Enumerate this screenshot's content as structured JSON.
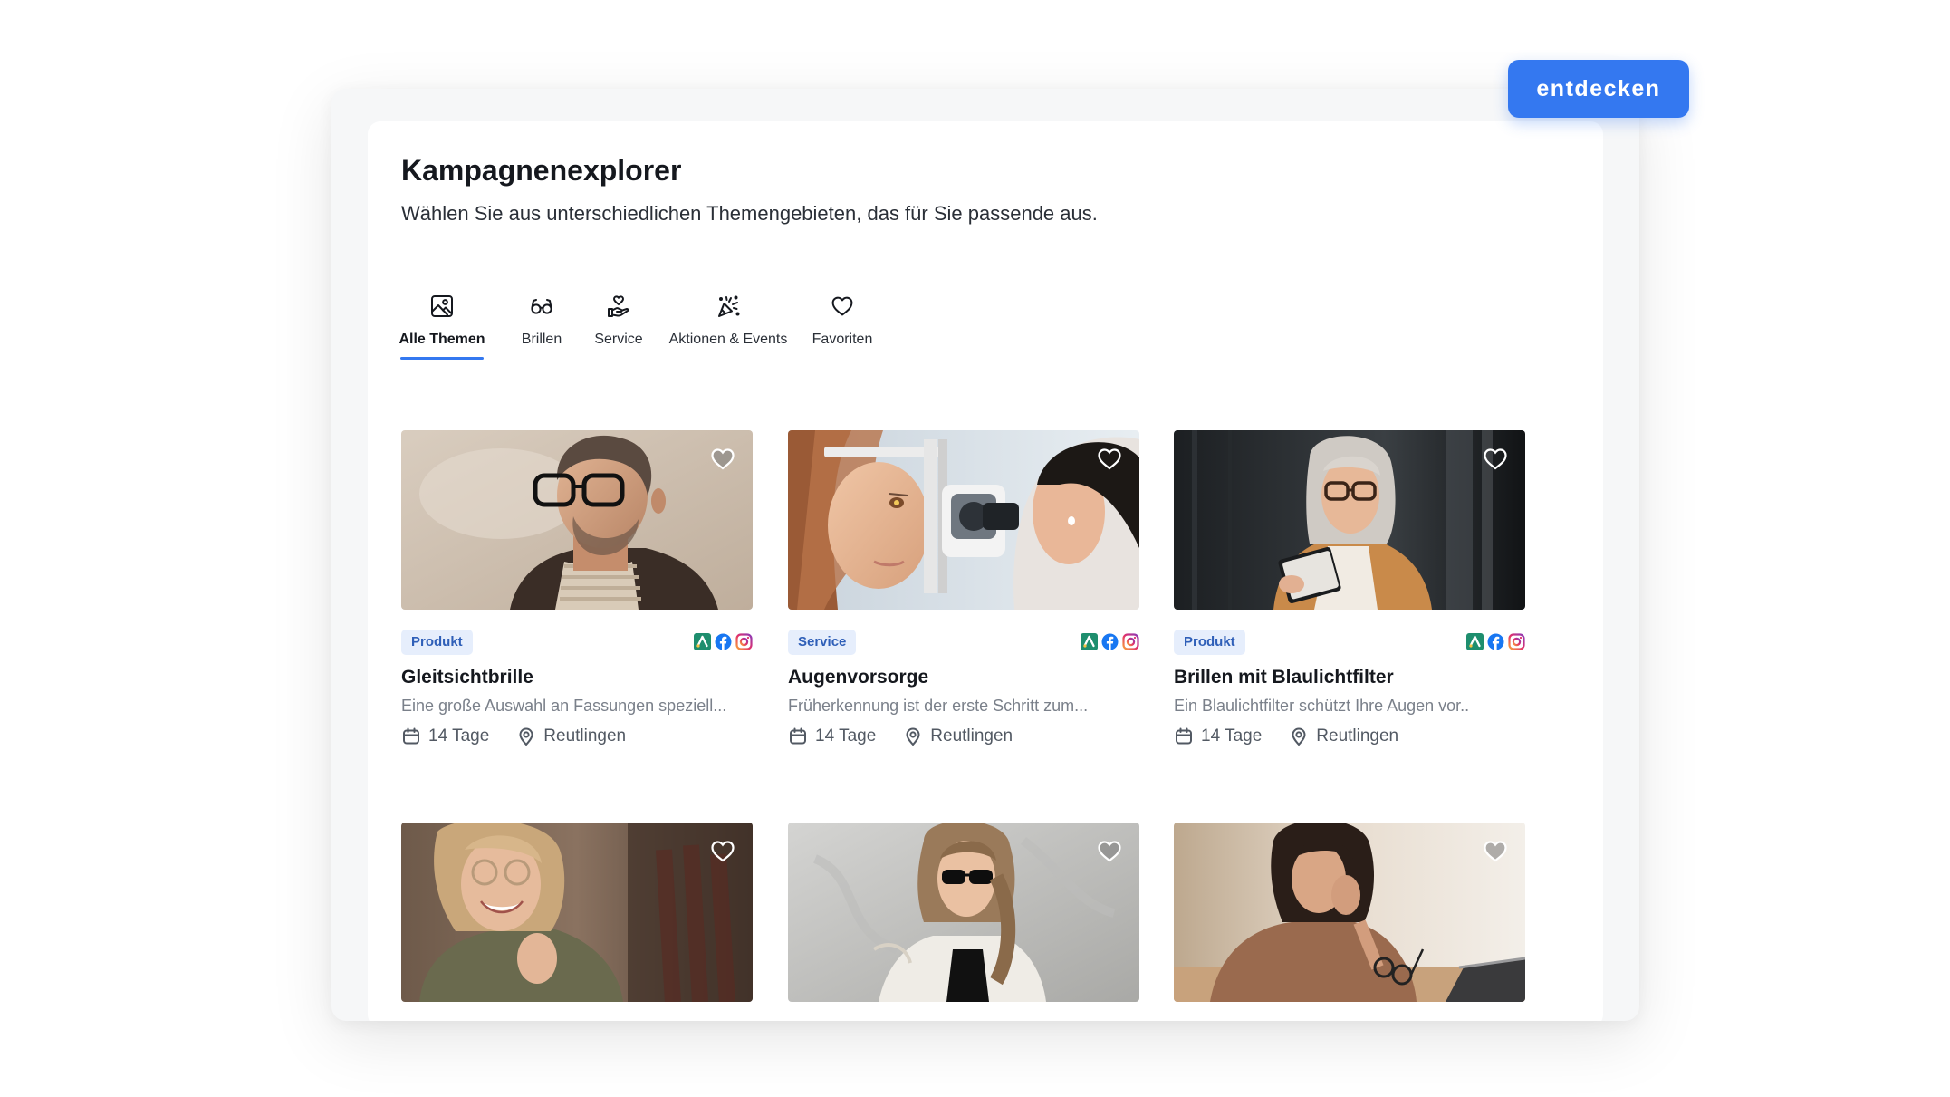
{
  "header": {
    "title": "Kampagnenexplorer",
    "subtitle": "Wählen Sie aus unterschiedlichen Themengebieten, das für Sie passende aus.",
    "discover_label": "entdecken"
  },
  "tabs": [
    {
      "label": "Alle Themen",
      "icon": "image-icon",
      "active": true
    },
    {
      "label": "Brillen",
      "icon": "glasses-icon",
      "active": false
    },
    {
      "label": "Service",
      "icon": "hand-heart-icon",
      "active": false
    },
    {
      "label": "Aktionen & Events",
      "icon": "sparkles-icon",
      "active": false
    },
    {
      "label": "Favoriten",
      "icon": "heart-icon",
      "active": false
    }
  ],
  "cards": [
    {
      "category": "Produkt",
      "title": "Gleitsichtbrille",
      "description": "Eine große Auswahl an Fassungen speziell...",
      "duration": "14 Tage",
      "location": "Reutlingen",
      "favorite_icon": "heart-outline-icon"
    },
    {
      "category": "Service",
      "title": "Augenvorsorge",
      "description": "Früherkennung ist der erste Schritt zum...",
      "duration": "14 Tage",
      "location": "Reutlingen",
      "favorite_icon": "heart-outline-icon"
    },
    {
      "category": "Produkt",
      "title": "Brillen mit Blaulichtfilter",
      "description": "Ein Blaulichtfilter schützt Ihre Augen vor..",
      "duration": "14 Tage",
      "location": "Reutlingen",
      "favorite_icon": "heart-outline-icon"
    },
    {
      "favorite_icon": "heart-outline-icon"
    },
    {
      "favorite_icon": "heart-outline-icon"
    },
    {
      "favorite_icon": "heart-outline-icon"
    }
  ],
  "social_icons": [
    "google-ads-icon",
    "facebook-icon",
    "instagram-icon"
  ],
  "colors": {
    "accent": "#3478f0",
    "badge_background": "#e6eefc",
    "badge_text": "#2f5fb8",
    "facebook": "#1877f2",
    "instagram": "#e1306c",
    "google_ads": "#1e8e6e"
  }
}
